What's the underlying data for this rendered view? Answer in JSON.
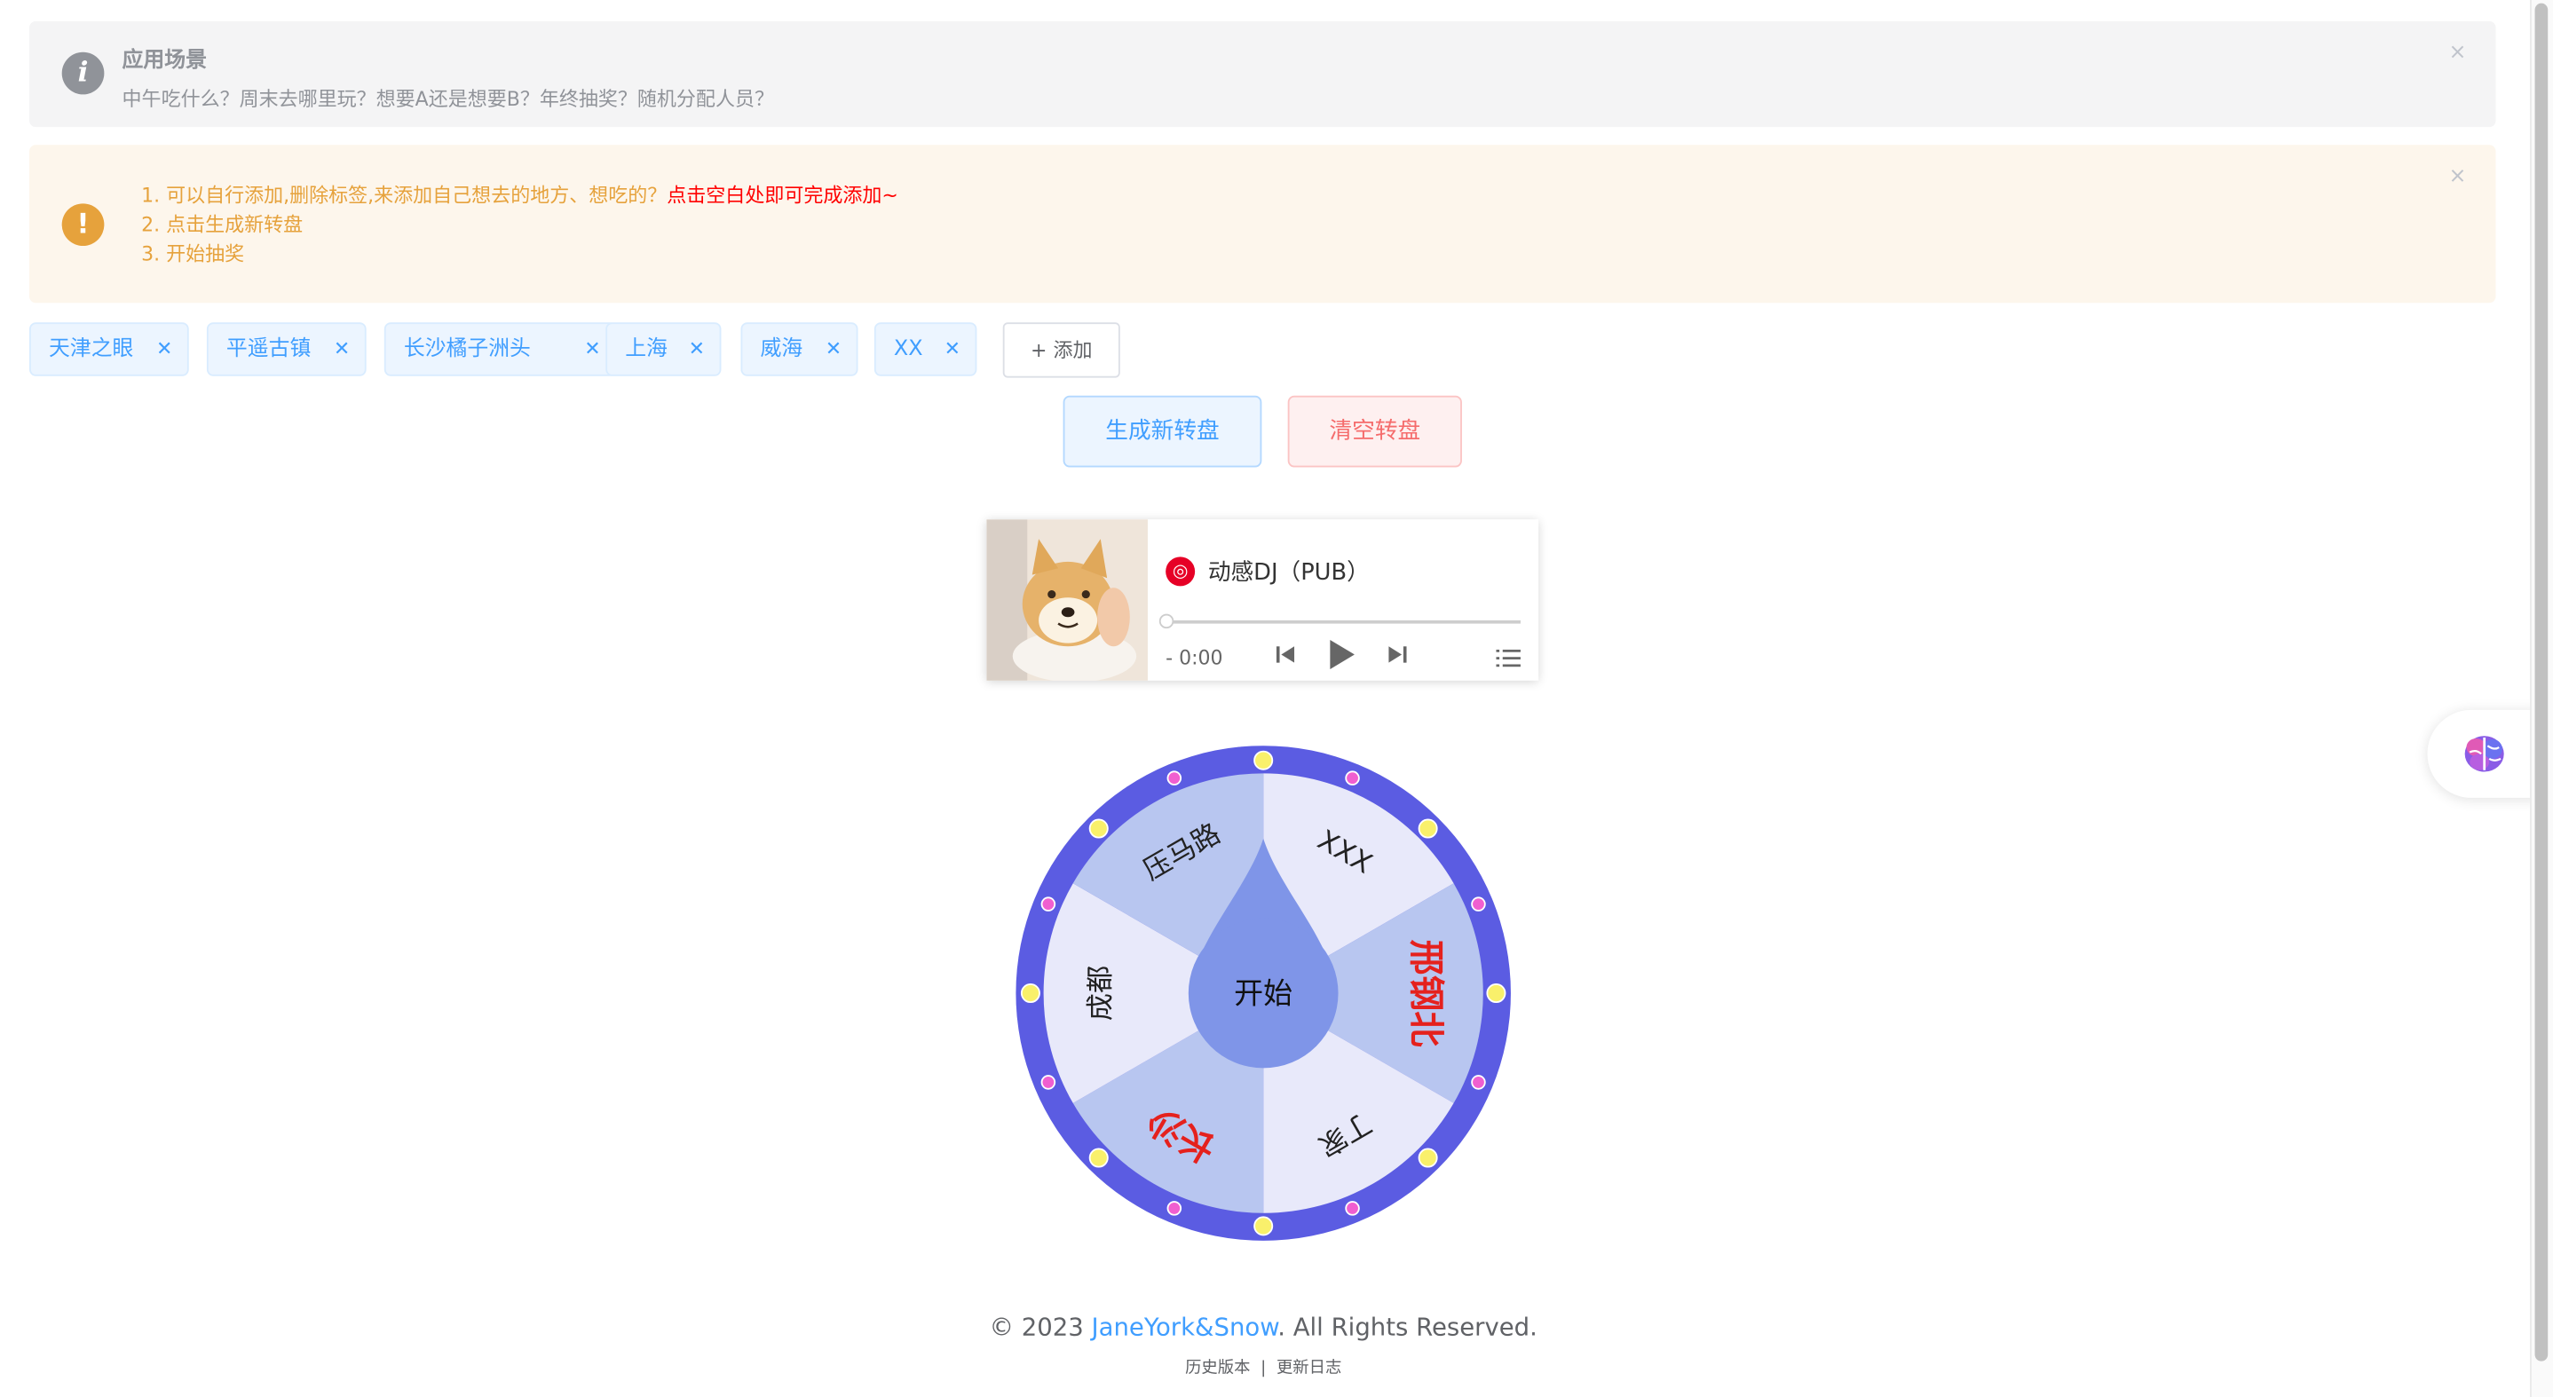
{
  "alerts": {
    "info": {
      "title": "应用场景",
      "description": "中午吃什么？周末去哪里玩？想要A还是想要B？年终抽奖？随机分配人员？"
    },
    "warning": {
      "step1": "可以自行添加,删除标签,来添加自己想去的地方、想吃的？",
      "step1_highlight": "点击空白处即可完成添加~",
      "step2": "点击生成新转盘",
      "step3": "开始抽奖"
    },
    "close_glyph": "×"
  },
  "tags": [
    {
      "label": "天津之眼"
    },
    {
      "label": "平遥古镇"
    },
    {
      "label": "长沙橘子洲头"
    },
    {
      "label": "上海"
    },
    {
      "label": "威海"
    },
    {
      "label": "XX"
    }
  ],
  "add_label": "+ 添加",
  "buttons": {
    "generate": "生成新转盘",
    "clear": "清空转盘"
  },
  "player": {
    "title": "动感DJ（PUB）",
    "time": "- 0:00"
  },
  "wheel": {
    "center": "开始",
    "prizes": [
      "XXX",
      "邢钢北",
      "丁家",
      "长沙",
      "成都",
      "压马路"
    ],
    "highlighted": [
      "邢钢北",
      "长沙"
    ],
    "colors": {
      "rim": "#5b5ce2",
      "light": "#e8e9fa",
      "dark": "#b8c6f0",
      "pointer": "#7f95e8",
      "highlight": "#e5211d"
    }
  },
  "footer": {
    "prefix": "© 2023 ",
    "link": "JaneYork&Snow",
    "suffix": ". All Rights Reserved.",
    "history": "历史版本",
    "separator": "|",
    "changelog": "更新日志"
  },
  "icons": {
    "info": "info-icon",
    "warning": "warning-icon",
    "music": "netease-music-icon",
    "brain": "brain-icon"
  }
}
